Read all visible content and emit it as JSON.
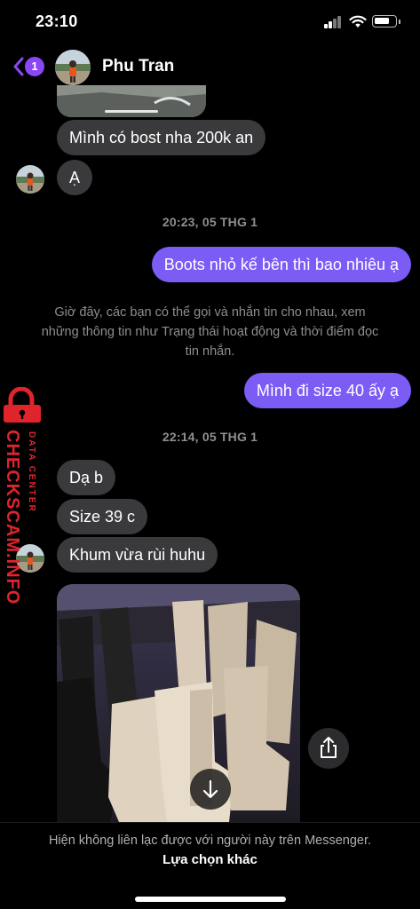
{
  "status_bar": {
    "time": "23:10"
  },
  "header": {
    "unread_count": "1",
    "contact_name": "Phu Tran",
    "accent_color": "#8a47f5"
  },
  "messages_before": [
    {
      "text": "Mình có bost nha 200k an",
      "direction": "incoming"
    },
    {
      "text": "Ạ",
      "direction": "incoming"
    }
  ],
  "timestamp_1": "20:23, 05 THG 1",
  "outgoing_1": "Boots nhỏ kế bên thì bao nhiêu ạ",
  "system_notice": {
    "line1": "Giờ đây, các bạn có thể gọi và nhắn tin cho nhau, xem",
    "line2": "những thông tin như Trạng thái hoạt động và thời điểm đọc",
    "line3": "tin nhắn."
  },
  "outgoing_2": "Mình đi size 40 ấy ạ",
  "timestamp_2": "22:14, 05 THG 1",
  "messages_after": [
    {
      "text": "Dạ b",
      "direction": "incoming"
    },
    {
      "text": "Size 39 c",
      "direction": "incoming"
    },
    {
      "text": "Khum vừa rùi huhu",
      "direction": "incoming"
    }
  ],
  "watermark": {
    "brand": "CHECKSCAM.INFO",
    "tagline": "DATA CENTER",
    "color": "#e0242c"
  },
  "footer": {
    "notice": "Hiện không liên lạc được với người này trên Messenger.",
    "action": "Lựa chọn khác"
  },
  "colors": {
    "outgoing_bubble": "#7b5cf5",
    "incoming_bubble": "#3a3a3c",
    "background": "#000000"
  }
}
